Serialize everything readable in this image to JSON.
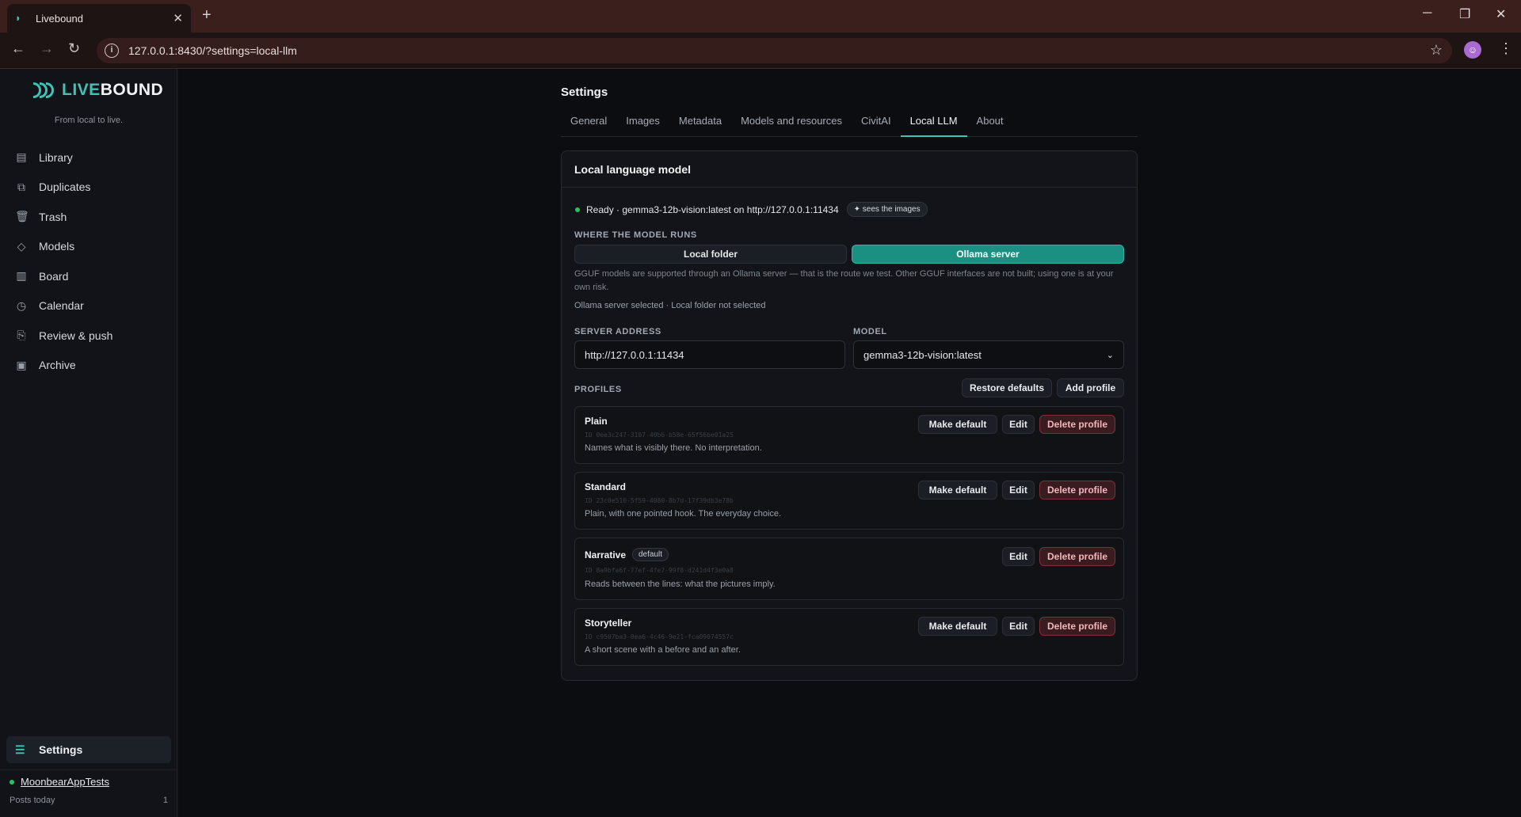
{
  "browser": {
    "tab_title": "Livebound",
    "url": "127.0.0.1:8430/?settings=local-llm"
  },
  "sidebar": {
    "brand": "LIVEBOUND",
    "tagline": "From local to live.",
    "items": [
      {
        "label": "Library",
        "icon": "library-icon"
      },
      {
        "label": "Duplicates",
        "icon": "duplicates-icon"
      },
      {
        "label": "Trash",
        "icon": "trash-icon"
      },
      {
        "label": "Models",
        "icon": "models-icon"
      },
      {
        "label": "Board",
        "icon": "board-icon"
      },
      {
        "label": "Calendar",
        "icon": "calendar-icon"
      },
      {
        "label": "Review & push",
        "icon": "review-icon"
      },
      {
        "label": "Archive",
        "icon": "archive-icon"
      }
    ],
    "settings_label": "Settings",
    "account": "MoonbearAppTests",
    "posts_label": "Posts today",
    "posts_count": "1"
  },
  "page": {
    "title": "Settings",
    "tabs": [
      "General",
      "Images",
      "Metadata",
      "Models and resources",
      "CivitAI",
      "Local LLM",
      "About"
    ],
    "active_tab": "Local LLM"
  },
  "llm": {
    "card_title": "Local language model",
    "status_text": "Ready · gemma3-12b-vision:latest on http://127.0.0.1:11434",
    "status_chip": "✦ sees the images",
    "where_label": "WHERE THE MODEL RUNS",
    "opt_local": "Local folder",
    "opt_ollama": "Ollama server",
    "help_text": "GGUF models are supported through an Ollama server — that is the route we test. Other GGUF interfaces are not built; using one is at your own risk.",
    "selection_note": "Ollama server selected · Local folder not selected",
    "server_label": "SERVER ADDRESS",
    "server_value": "http://127.0.0.1:11434",
    "model_label": "MODEL",
    "model_value": "gemma3-12b-vision:latest",
    "profiles_label": "PROFILES",
    "restore_label": "Restore defaults",
    "add_label": "Add profile"
  },
  "profiles": [
    {
      "name": "Plain",
      "id": "ID 0ee3c247-3107-40b6-b58e-65f56be01a25",
      "desc": "Names what is visibly there. No interpretation.",
      "badge": ""
    },
    {
      "name": "Standard",
      "id": "ID 23c0e510-5f59-4080-8b7d-17f39db3e78b",
      "desc": "Plain, with one pointed hook. The everyday choice.",
      "badge": ""
    },
    {
      "name": "Narrative",
      "id": "ID 8a9bfa6f-77ef-4fe7-99f8-d241d4f3e0a8",
      "desc": "Reads between the lines: what the pictures imply.",
      "badge": "default"
    },
    {
      "name": "Storyteller",
      "id": "ID c9507ba3-0ea6-4c46-9e21-fca09074557c",
      "desc": "A short scene with a before and an after.",
      "badge": ""
    }
  ],
  "actions": {
    "make_default": "Make default",
    "edit": "Edit",
    "delete": "Delete profile"
  }
}
